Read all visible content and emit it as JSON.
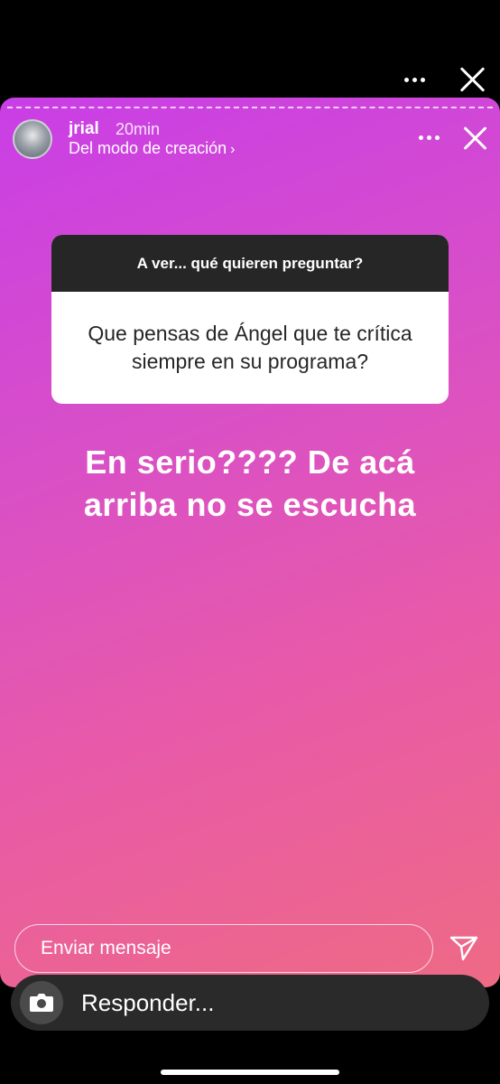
{
  "story": {
    "username": "jrial",
    "time": "20min",
    "subtitle": "Del modo de creación",
    "subtitle_chevron": "›"
  },
  "question_sticker": {
    "prompt": "A ver... qué quieren preguntar?",
    "question": "Que pensas de Ángel que te crítica siempre en su programa?"
  },
  "answer_lines": [
    "En serio???? De acá",
    "arriba no se escucha"
  ],
  "message_input": {
    "placeholder": "Enviar mensaje"
  },
  "reply_bar": {
    "label": "Responder..."
  },
  "icons": {
    "more": "more-horizontal-icon",
    "close": "close-icon",
    "send": "send-icon",
    "camera": "camera-icon"
  },
  "colors": {
    "gradient_start": "#c93ee6",
    "gradient_end": "#ee6a84",
    "question_header": "#262626",
    "reply_bar": "#2a2a2a"
  }
}
